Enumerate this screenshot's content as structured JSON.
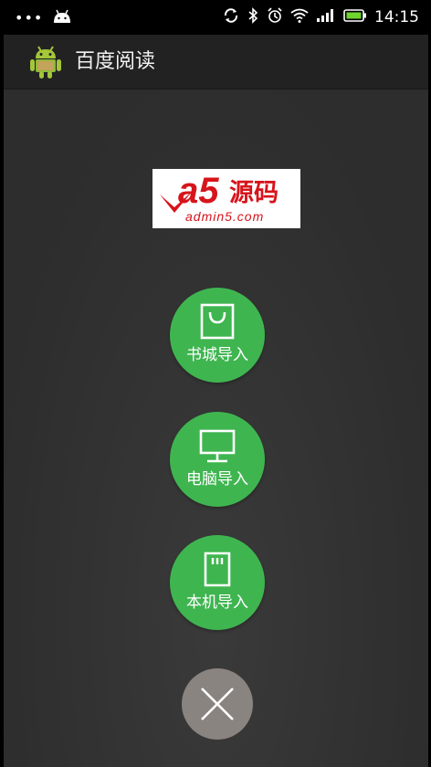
{
  "status_bar": {
    "dots": "•••",
    "time": "14:15"
  },
  "action_bar": {
    "title": "百度阅读"
  },
  "logo": {
    "main": "a5",
    "cn": "源码",
    "url": "admin5.com"
  },
  "buttons": [
    {
      "label": "书城导入",
      "icon": "shopping-bag-icon"
    },
    {
      "label": "电脑导入",
      "icon": "monitor-icon"
    },
    {
      "label": "本机导入",
      "icon": "sd-card-icon"
    }
  ],
  "close": {
    "icon": "close-icon"
  },
  "colors": {
    "accent_green": "#3fb550",
    "close_gray": "#8a8480",
    "logo_red": "#d7141b",
    "battery_green": "#6fd42d"
  }
}
